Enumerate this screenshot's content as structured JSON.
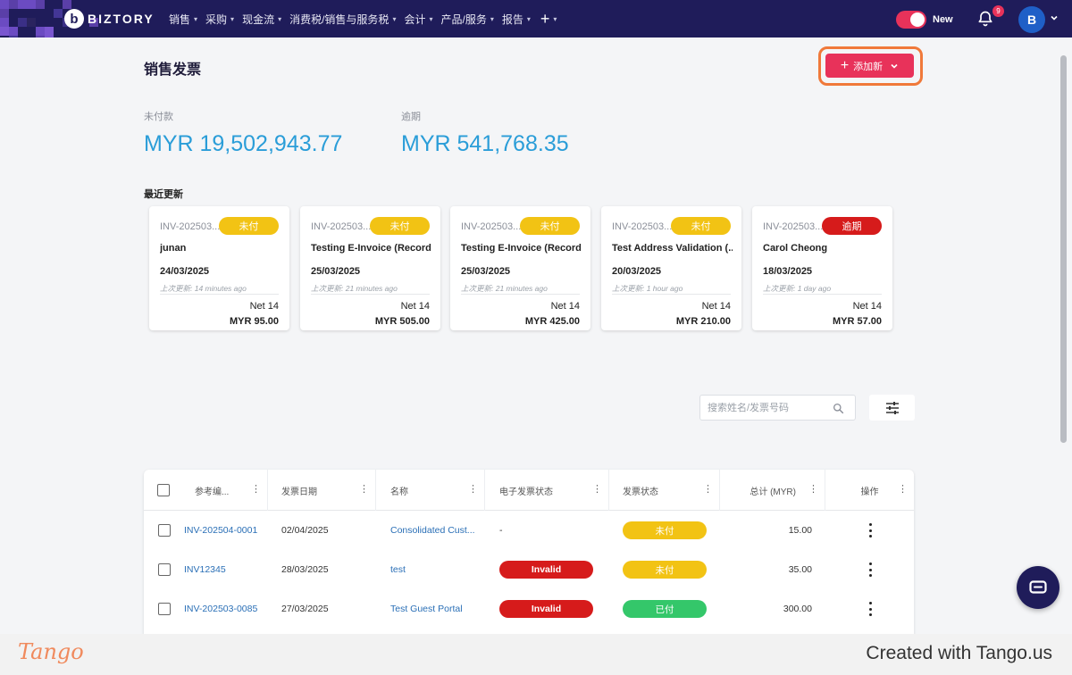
{
  "nav": {
    "logo_mark": "b",
    "logo_text": "BIZTORY",
    "menu": [
      "销售",
      "采购",
      "现金流",
      "消费税/销售与服务税",
      "会计",
      "产品/服务",
      "报告"
    ],
    "plus": "+",
    "toggle_label": "New",
    "notifications": "9",
    "avatar": "B"
  },
  "page": {
    "title": "销售发票",
    "add_button": "添加新"
  },
  "summary": {
    "unpaid_label": "未付款",
    "unpaid_amount": "MYR 19,502,943.77",
    "overdue_label": "逾期",
    "overdue_amount": "MYR 541,768.35"
  },
  "recent": {
    "title": "最近更新",
    "cards": [
      {
        "ref": "INV-202503...",
        "status": "未付",
        "status_type": "unpaid",
        "name": "junan",
        "date": "24/03/2025",
        "updated": "上次更新: 14 minutes ago",
        "terms": "Net 14",
        "total": "MYR 95.00"
      },
      {
        "ref": "INV-202503...",
        "status": "未付",
        "status_type": "unpaid",
        "name": "Testing E-Invoice (Record)",
        "date": "25/03/2025",
        "updated": "上次更新: 21 minutes ago",
        "terms": "Net 14",
        "total": "MYR 505.00"
      },
      {
        "ref": "INV-202503...",
        "status": "未付",
        "status_type": "unpaid",
        "name": "Testing E-Invoice (Record)",
        "date": "25/03/2025",
        "updated": "上次更新: 21 minutes ago",
        "terms": "Net 14",
        "total": "MYR 425.00"
      },
      {
        "ref": "INV-202503...",
        "status": "未付",
        "status_type": "unpaid",
        "name": "Test Address Validation (...",
        "date": "20/03/2025",
        "updated": "上次更新: 1 hour ago",
        "terms": "Net 14",
        "total": "MYR 210.00"
      },
      {
        "ref": "INV-202503...",
        "status": "逾期",
        "status_type": "overdue",
        "name": "Carol Cheong",
        "date": "18/03/2025",
        "updated": "上次更新: 1 day ago",
        "terms": "Net 14",
        "total": "MYR 57.00"
      }
    ]
  },
  "search": {
    "placeholder": "搜索姓名/发票号码"
  },
  "table": {
    "headers": [
      "参考编...",
      "发票日期",
      "名称",
      "电子发票状态",
      "发票状态",
      "总计 (MYR)",
      "操作"
    ],
    "rows": [
      {
        "ref": "INV-202504-0001",
        "date": "02/04/2025",
        "name": "Consolidated Cust...",
        "einvoice": "-",
        "einvoice_type": "none",
        "status": "未付",
        "status_type": "unpaid",
        "total": "15.00"
      },
      {
        "ref": "INV12345",
        "date": "28/03/2025",
        "name": "test",
        "einvoice": "Invalid",
        "einvoice_type": "invalid",
        "status": "未付",
        "status_type": "unpaid",
        "total": "35.00"
      },
      {
        "ref": "INV-202503-0085",
        "date": "27/03/2025",
        "name": "Test Guest Portal",
        "einvoice": "Invalid",
        "einvoice_type": "invalid",
        "status": "已付",
        "status_type": "paid",
        "total": "300.00"
      }
    ]
  },
  "colors": {
    "navbar": "#1f1c5a",
    "accent": "#e8325a",
    "amount": "#2a9dd8",
    "unpaid": "#f2c314",
    "overdue": "#d61b1b",
    "paid": "#34c76a"
  },
  "icons": {
    "bell": "bell-icon",
    "search": "search-icon",
    "filter": "sliders-icon",
    "chat": "chat-icon"
  },
  "footer": {
    "logo": "Tango",
    "created": "Created with Tango.us"
  }
}
